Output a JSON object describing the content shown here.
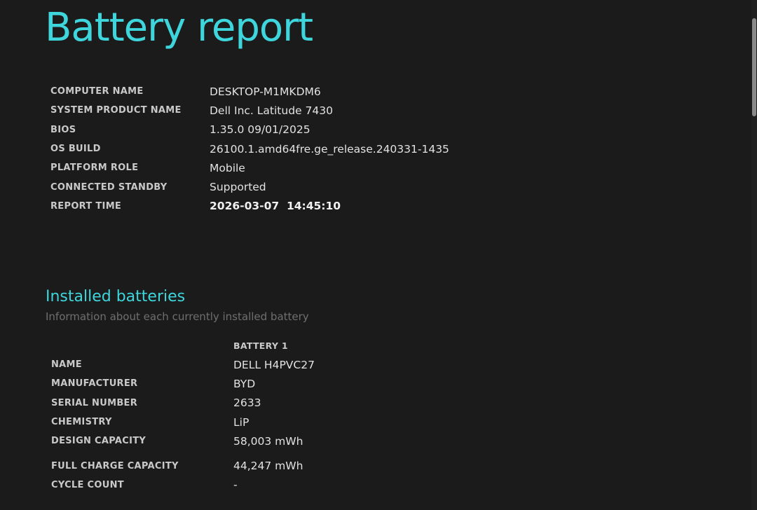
{
  "title": "Battery report",
  "system_info": [
    {
      "label": "COMPUTER NAME",
      "value": "DESKTOP-M1MKDM6"
    },
    {
      "label": "SYSTEM PRODUCT NAME",
      "value": "Dell Inc. Latitude 7430"
    },
    {
      "label": "BIOS",
      "value": "1.35.0 09/01/2025"
    },
    {
      "label": "OS BUILD",
      "value": "26100.1.amd64fre.ge_release.240331-1435"
    },
    {
      "label": "PLATFORM ROLE",
      "value": "Mobile"
    },
    {
      "label": "CONNECTED STANDBY",
      "value": "Supported"
    },
    {
      "label": "REPORT TIME",
      "value": "2026-03-07  14:45:10"
    }
  ],
  "installed_batteries": {
    "title": "Installed batteries",
    "subtitle": "Information about each currently installed battery",
    "column_header": "BATTERY 1",
    "rows": [
      {
        "label": "NAME",
        "value": "DELL H4PVC27"
      },
      {
        "label": "MANUFACTURER",
        "value": "BYD"
      },
      {
        "label": "SERIAL NUMBER",
        "value": "2633"
      },
      {
        "label": "CHEMISTRY",
        "value": "LiP"
      },
      {
        "label": "DESIGN CAPACITY",
        "value": "58,003 mWh"
      },
      {
        "label": "FULL CHARGE CAPACITY",
        "value": "44,247 mWh"
      },
      {
        "label": "CYCLE COUNT",
        "value": "-"
      }
    ]
  },
  "colors": {
    "accent": "#3ed6dc",
    "background": "#1b1b1b"
  }
}
